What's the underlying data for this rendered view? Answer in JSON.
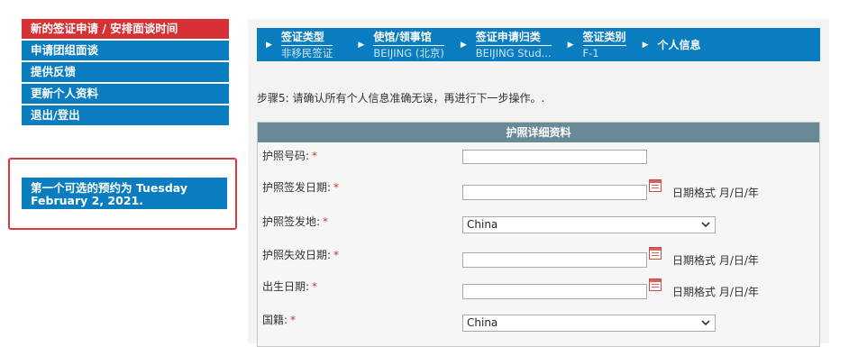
{
  "nav": {
    "items": [
      {
        "label": "新的签证申请 / 安排面谈时间",
        "active": true
      },
      {
        "label": "申请团组面谈",
        "active": false
      },
      {
        "label": "提供反馈",
        "active": false
      },
      {
        "label": "更新个人资料",
        "active": false
      },
      {
        "label": "退出/登出",
        "active": false
      }
    ]
  },
  "appointment_notice": "第一个可选的预约为 Tuesday February 2, 2021.",
  "breadcrumb": {
    "steps": [
      {
        "title": "签证类型",
        "value": "非移民签证"
      },
      {
        "title": "使馆/领事馆",
        "value": "BEIJING (北京)"
      },
      {
        "title": "签证申请归类",
        "value": "BEIJING Stud..."
      },
      {
        "title": "签证类别",
        "value": "F-1"
      }
    ],
    "current": "个人信息"
  },
  "step_instruction": "步骤5: 请确认所有个人信息准确无误，再进行下一步操作。.",
  "form": {
    "header": "护照详细资料",
    "required_mark": "*",
    "date_format_hint": "日期格式 月/日/年",
    "fields": {
      "passport_number": {
        "label": "护照号码:",
        "value": ""
      },
      "issue_date": {
        "label": "护照签发日期:",
        "value": ""
      },
      "issue_place": {
        "label": "护照签发地:",
        "value": "China"
      },
      "expiry_date": {
        "label": "护照失效日期:",
        "value": ""
      },
      "birth_date": {
        "label": "出生日期:",
        "value": ""
      },
      "nationality": {
        "label": "国籍:",
        "value": "China"
      }
    }
  },
  "colors": {
    "nav_blue": "#0a7dc0",
    "nav_active_red": "#d63236",
    "form_header": "#678a96",
    "required_red": "#d63236"
  }
}
